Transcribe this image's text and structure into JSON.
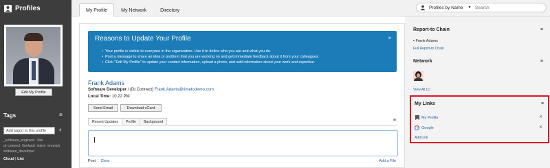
{
  "app": {
    "title": "Profiles",
    "icon": "profile-icon"
  },
  "tabs": [
    {
      "label": "My Profile",
      "active": true
    },
    {
      "label": "My Network",
      "active": false
    },
    {
      "label": "Directory",
      "active": false
    }
  ],
  "search": {
    "mode": "Profiles by Name",
    "placeholder": "Search"
  },
  "sidebar": {
    "edit_profile": "Edit My Profile",
    "tags_title": "Tags",
    "tags_placeholder": "Add tag(s) to this profile",
    "tags_add": "+",
    "tag_items": [
      "_software_engineer",
      "34a",
      "dr connect",
      "firmland",
      "intern",
      "imunich",
      "software_developer"
    ],
    "view_cloud": "Cloud",
    "view_sep": "|",
    "view_list": "List"
  },
  "banner": {
    "title": "Reasons to Update Your Profile",
    "close": "×",
    "items": [
      "Your profile is visible to everyone in the organization. Use it to define who you are and what you do.",
      "Post a message to share an idea or problem that you are working on and get immediate feedback about it from your colleagues.",
      "Click \"Edit My Profile\" to update your contact information, upload a photo, and add information about your work and expertise."
    ]
  },
  "person": {
    "name": "Frank Adams",
    "role": "Software Developer",
    "org": " / (Dr.Connect) ",
    "email": "Frank.Adams@timetodemo.com",
    "time_label": "Local Time:",
    "time_value": " 10:22 PM"
  },
  "actions": {
    "send_email": "Send Email",
    "download_vcard": "Download vCard"
  },
  "profile_tabs": [
    {
      "label": "Recent Updates",
      "active": true
    },
    {
      "label": "Profile",
      "active": false
    },
    {
      "label": "Background",
      "active": false
    }
  ],
  "post": {
    "post_label": "Post",
    "sep": "|",
    "clear_label": "Clear",
    "add_file": "Add a File"
  },
  "right": {
    "report_chain": {
      "title": "Report-to Chain",
      "item": "Frank Adams",
      "full_link": "Full Report-to Chain"
    },
    "network": {
      "title": "Network",
      "view_all": "View All (1)"
    },
    "my_links": {
      "title": "My Links",
      "items": [
        {
          "label": "My Profile",
          "icon": "bookmark-icon"
        },
        {
          "label": "Google",
          "icon": "google-icon"
        }
      ],
      "add": "Add Link"
    },
    "menu_glyph": "≡",
    "remove_glyph": "✕"
  },
  "colors": {
    "sidebar": "#3d3d3d",
    "banner": "#1b7cb8",
    "link": "#1b5e9b",
    "highlight": "#d9161f"
  }
}
